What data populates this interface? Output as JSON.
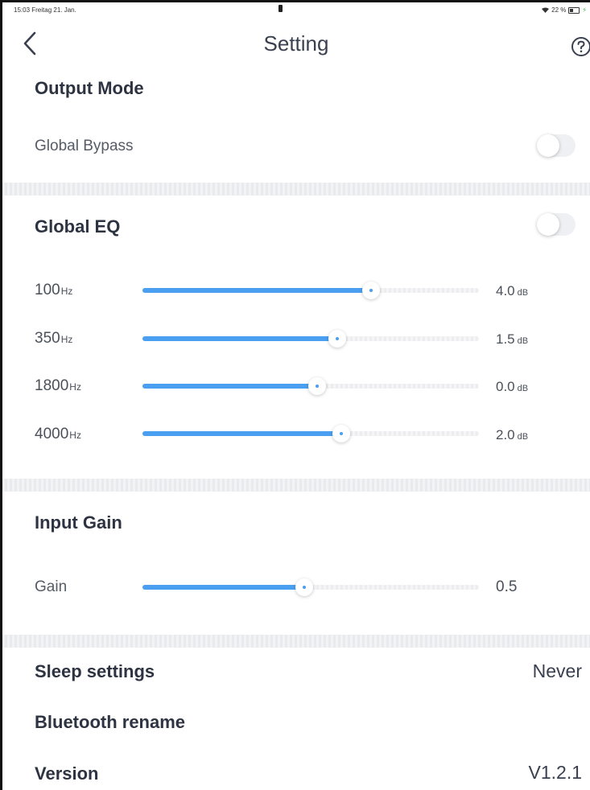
{
  "status_bar": {
    "left_text": "15:03  Freitag 21. Jan.",
    "right_text": "22 %"
  },
  "header": {
    "title": "Setting"
  },
  "output_mode": {
    "title": "Output Mode",
    "global_bypass": {
      "label": "Global Bypass",
      "enabled": false
    }
  },
  "global_eq": {
    "title": "Global EQ",
    "enabled": false,
    "bands": [
      {
        "freq": "100",
        "freq_unit": "Hz",
        "value": "4.0",
        "value_unit": "dB",
        "level": 0.68
      },
      {
        "freq": "350",
        "freq_unit": "Hz",
        "value": "1.5",
        "value_unit": "dB",
        "level": 0.58
      },
      {
        "freq": "1800",
        "freq_unit": "Hz",
        "value": "0.0",
        "value_unit": "dB",
        "level": 0.52
      },
      {
        "freq": "4000",
        "freq_unit": "Hz",
        "value": "2.0",
        "value_unit": "dB",
        "level": 0.59
      }
    ]
  },
  "input_gain": {
    "title": "Input Gain",
    "gain_label": "Gain",
    "gain_value": "0.5",
    "level": 0.48
  },
  "sleep_settings": {
    "label": "Sleep settings",
    "value": "Never"
  },
  "bluetooth_rename": {
    "label": "Bluetooth rename"
  },
  "version": {
    "label": "Version",
    "value": "V1.2.1"
  },
  "colors": {
    "accent": "#4a9ff0",
    "text": "#2d3340",
    "muted": "#555c66"
  },
  "icons": {
    "back": "chevron-left-icon",
    "help": "question-circle-icon"
  }
}
